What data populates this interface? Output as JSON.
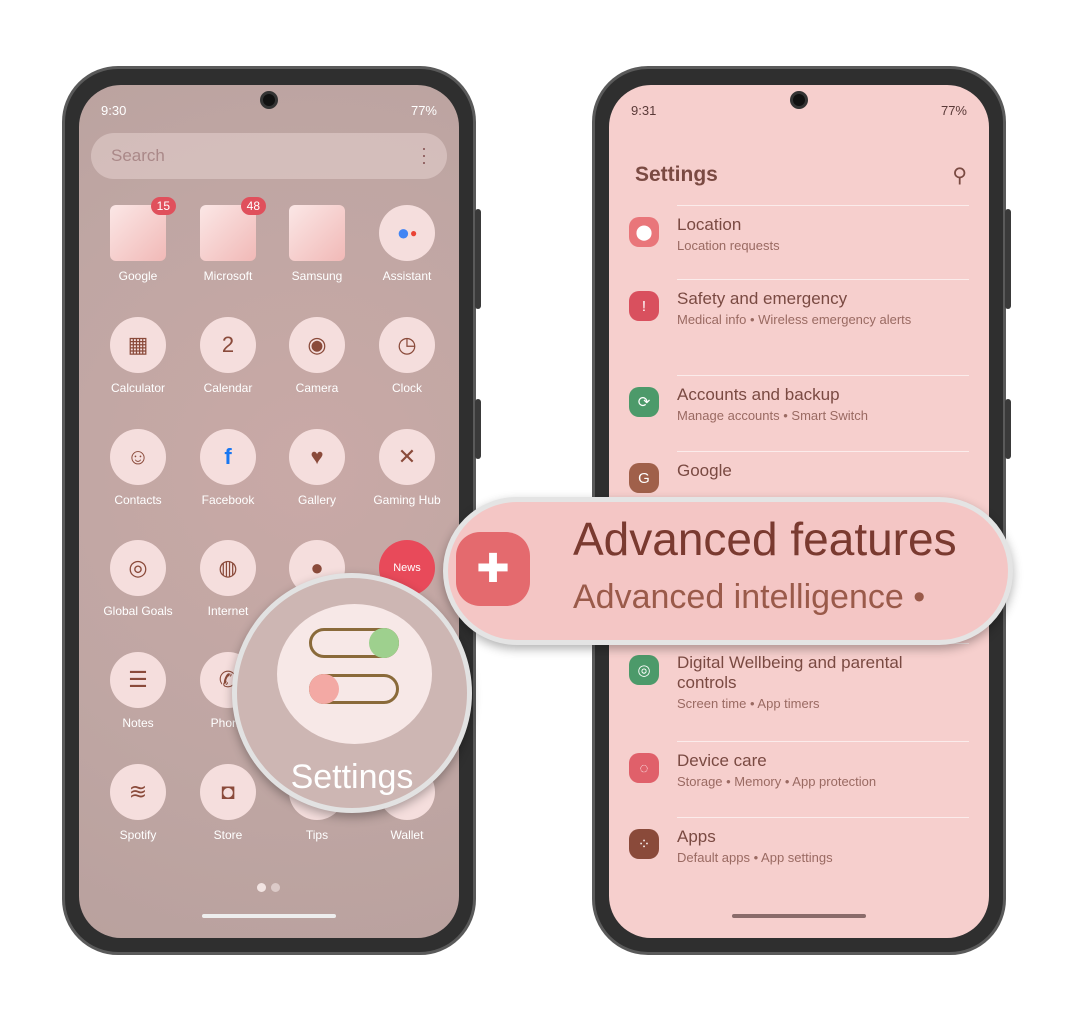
{
  "left_phone": {
    "status": {
      "time": "9:30",
      "right": "77%"
    },
    "search_placeholder": "Search",
    "apps": [
      {
        "label": "Google",
        "badge": "15",
        "icon": "folder-icon"
      },
      {
        "label": "Microsoft",
        "badge": "48",
        "icon": "folder-icon"
      },
      {
        "label": "Samsung",
        "icon": "folder-icon"
      },
      {
        "label": "Assistant",
        "icon": "assistant-icon"
      },
      {
        "label": "Calculator",
        "icon": "calculator-icon",
        "glyph": "▦"
      },
      {
        "label": "Calendar",
        "icon": "calendar-icon",
        "glyph": "2"
      },
      {
        "label": "Camera",
        "icon": "camera-icon",
        "glyph": "◉"
      },
      {
        "label": "Clock",
        "icon": "clock-icon",
        "glyph": "◷"
      },
      {
        "label": "Contacts",
        "icon": "contacts-icon",
        "glyph": "☺"
      },
      {
        "label": "Facebook",
        "icon": "facebook-icon",
        "glyph": "f"
      },
      {
        "label": "Gallery",
        "icon": "gallery-icon",
        "glyph": "♥"
      },
      {
        "label": "Gaming Hub",
        "icon": "gaming-hub-icon",
        "glyph": "✕"
      },
      {
        "label": "Global Goals",
        "icon": "global-goals-icon",
        "glyph": "◎"
      },
      {
        "label": "Internet",
        "icon": "internet-icon",
        "glyph": "◍"
      },
      {
        "label": "",
        "icon": "messages-icon",
        "glyph": "●"
      },
      {
        "label": "",
        "icon": "news-icon",
        "glyph": "News"
      },
      {
        "label": "Notes",
        "icon": "notes-icon",
        "glyph": "☰"
      },
      {
        "label": "Phone",
        "icon": "phone-icon",
        "glyph": "✆"
      },
      {
        "label": "",
        "icon": "settings-icon",
        "glyph": ""
      },
      {
        "label": "",
        "icon": "app-icon",
        "glyph": ""
      },
      {
        "label": "Spotify",
        "icon": "spotify-icon",
        "glyph": "≋"
      },
      {
        "label": "Store",
        "icon": "store-icon",
        "glyph": "◘"
      },
      {
        "label": "Tips",
        "icon": "tips-icon",
        "glyph": ""
      },
      {
        "label": "Wallet",
        "icon": "wallet-icon",
        "glyph": ""
      }
    ],
    "magnifier_label": "Settings"
  },
  "right_phone": {
    "status": {
      "time": "9:31",
      "right": "77%"
    },
    "title": "Settings",
    "items": [
      {
        "title": "Location",
        "subtitle": "Location requests",
        "color": "#e9767a",
        "glyph": "⬤"
      },
      {
        "title": "Safety and emergency",
        "subtitle": "Medical info  •  Wireless emergency alerts",
        "color": "#d9505e",
        "glyph": "!"
      },
      {
        "title": "Accounts and backup",
        "subtitle": "Manage accounts  •  Smart Switch",
        "color": "#4c9a6a",
        "glyph": "⟳"
      },
      {
        "title": "Google",
        "subtitle": "",
        "color": "#a0604a",
        "glyph": "G"
      },
      {
        "title": "Digital Wellbeing and parental controls",
        "subtitle": "Screen time  •  App timers",
        "color": "#4c9a6a",
        "glyph": "◎"
      },
      {
        "title": "Device care",
        "subtitle": "Storage  •  Memory  •  App protection",
        "color": "#e0606a",
        "glyph": "◌"
      },
      {
        "title": "Apps",
        "subtitle": "Default apps  •  App settings",
        "color": "#8a4a3a",
        "glyph": "⁘"
      }
    ]
  },
  "callout": {
    "title": "Advanced features",
    "subtitle": "Advanced intelligence  •",
    "color": "#e46a6e"
  }
}
